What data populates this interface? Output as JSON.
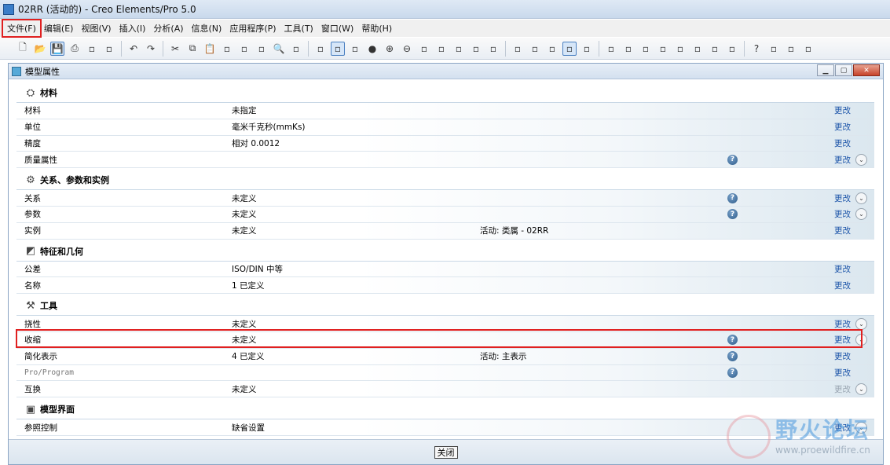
{
  "window": {
    "title": "02RR (活动的) - Creo Elements/Pro 5.0"
  },
  "menu": [
    "文件(F)",
    "编辑(E)",
    "视图(V)",
    "插入(I)",
    "分析(A)",
    "信息(N)",
    "应用程序(P)",
    "工具(T)",
    "窗口(W)",
    "帮助(H)"
  ],
  "toolbar_icons": [
    "new-file-icon",
    "open-icon",
    "save-icon",
    "print-icon",
    "print-preview-icon",
    "send-icon",
    "undo-icon",
    "redo-icon",
    "cut-icon",
    "copy-icon",
    "paste-icon",
    "paste-special-icon",
    "regenerate-icon",
    "regen-manager-icon",
    "find-icon",
    "select-box-icon",
    "redraw-icon",
    "spin-center-icon",
    "orient-icon",
    "shading-icon",
    "zoom-in-icon",
    "zoom-out-icon",
    "refit-icon",
    "reorient-icon",
    "saved-views-icon",
    "layers-icon",
    "view-manager-icon",
    "wireframe-icon",
    "hidden-line-icon",
    "no-hidden-icon",
    "shaded-icon",
    "enhanced-realism-icon",
    "datum-planes-icon",
    "datum-axes-icon",
    "point-display-icon",
    "csys-display-icon",
    "annotation-icon",
    "spin-icon",
    "datum-icon",
    "datum-curve-icon",
    "help-whats-this-icon",
    "sketch-icon",
    "copy-geom-icon",
    "table-icon"
  ],
  "dialog": {
    "title": "模型属性",
    "close_label": "关闭",
    "sections": [
      {
        "title": "材料",
        "icon": "material-icon",
        "rows": [
          {
            "label": "材料",
            "value": "未指定",
            "extra": "",
            "help": false,
            "change": "更改",
            "change_enabled": true,
            "expand": false
          },
          {
            "label": "单位",
            "value": "毫米千克秒(mmKs)",
            "extra": "",
            "help": false,
            "change": "更改",
            "change_enabled": true,
            "expand": false
          },
          {
            "label": "精度",
            "value": "相对 0.0012",
            "extra": "",
            "help": false,
            "change": "更改",
            "change_enabled": true,
            "expand": false
          },
          {
            "label": "质量属性",
            "value": "",
            "extra": "",
            "help": true,
            "change": "更改",
            "change_enabled": true,
            "expand": true
          }
        ]
      },
      {
        "title": "关系、参数和实例",
        "icon": "relations-icon",
        "rows": [
          {
            "label": "关系",
            "value": "未定义",
            "extra": "",
            "help": true,
            "change": "更改",
            "change_enabled": true,
            "expand": true
          },
          {
            "label": "参数",
            "value": "未定义",
            "extra": "",
            "help": true,
            "change": "更改",
            "change_enabled": true,
            "expand": true
          },
          {
            "label": "实例",
            "value": "未定义",
            "extra": "活动: 类属 - 02RR",
            "help": false,
            "change": "更改",
            "change_enabled": true,
            "expand": false
          }
        ]
      },
      {
        "title": "特征和几何",
        "icon": "feature-geometry-icon",
        "rows": [
          {
            "label": "公差",
            "value": "ISO/DIN 中等",
            "extra": "",
            "help": false,
            "change": "更改",
            "change_enabled": true,
            "expand": false
          },
          {
            "label": "名称",
            "value": "1 已定义",
            "extra": "",
            "help": false,
            "change": "更改",
            "change_enabled": true,
            "expand": false
          }
        ]
      },
      {
        "title": "工具",
        "icon": "tools-icon",
        "rows": [
          {
            "label": "挠性",
            "value": "未定义",
            "extra": "",
            "help": false,
            "change": "更改",
            "change_enabled": true,
            "expand": true
          },
          {
            "label": "收缩",
            "value": "未定义",
            "extra": "",
            "help": true,
            "change": "更改",
            "change_enabled": true,
            "expand": true
          },
          {
            "label": "简化表示",
            "value": "4 已定义",
            "extra": "活动: 主表示",
            "help": true,
            "change": "更改",
            "change_enabled": true,
            "expand": false
          },
          {
            "label": "Pro/Program",
            "value": "",
            "extra": "",
            "help": true,
            "change": "更改",
            "change_enabled": true,
            "expand": false,
            "gray": true
          },
          {
            "label": "互换",
            "value": "未定义",
            "extra": "",
            "help": false,
            "change": "更改",
            "change_enabled": false,
            "expand": true
          }
        ]
      },
      {
        "title": "模型界面",
        "icon": "model-interface-icon",
        "rows": [
          {
            "label": "参照控制",
            "value": "缺省设置",
            "extra": "",
            "help": false,
            "change": "更改",
            "change_enabled": true,
            "expand": true
          }
        ]
      }
    ]
  },
  "watermark": {
    "text": "野火论坛",
    "url": "www.proewildfire.cn"
  }
}
